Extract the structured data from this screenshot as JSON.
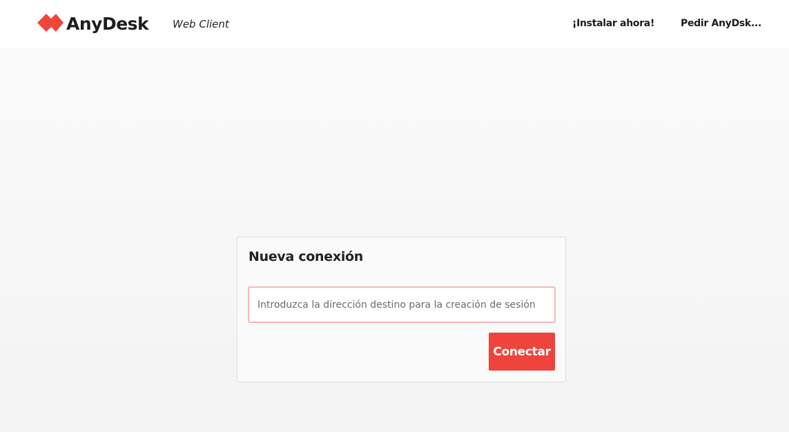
{
  "header": {
    "brand_name": "AnyDesk",
    "subtitle": "Web Client",
    "install_link": "¡Instalar ahora!",
    "order_link": "Pedir AnyDsk..."
  },
  "connection": {
    "title": "Nueva conexión",
    "address_placeholder": "Introduzca la dirección destino para la creación de sesión",
    "address_value": "",
    "connect_label": "Conectar"
  },
  "colors": {
    "brand_red": "#ef443b",
    "input_focus_border": "#f4b7b7"
  },
  "icons": {
    "logo": "anydesk-diamond-logo-icon"
  }
}
